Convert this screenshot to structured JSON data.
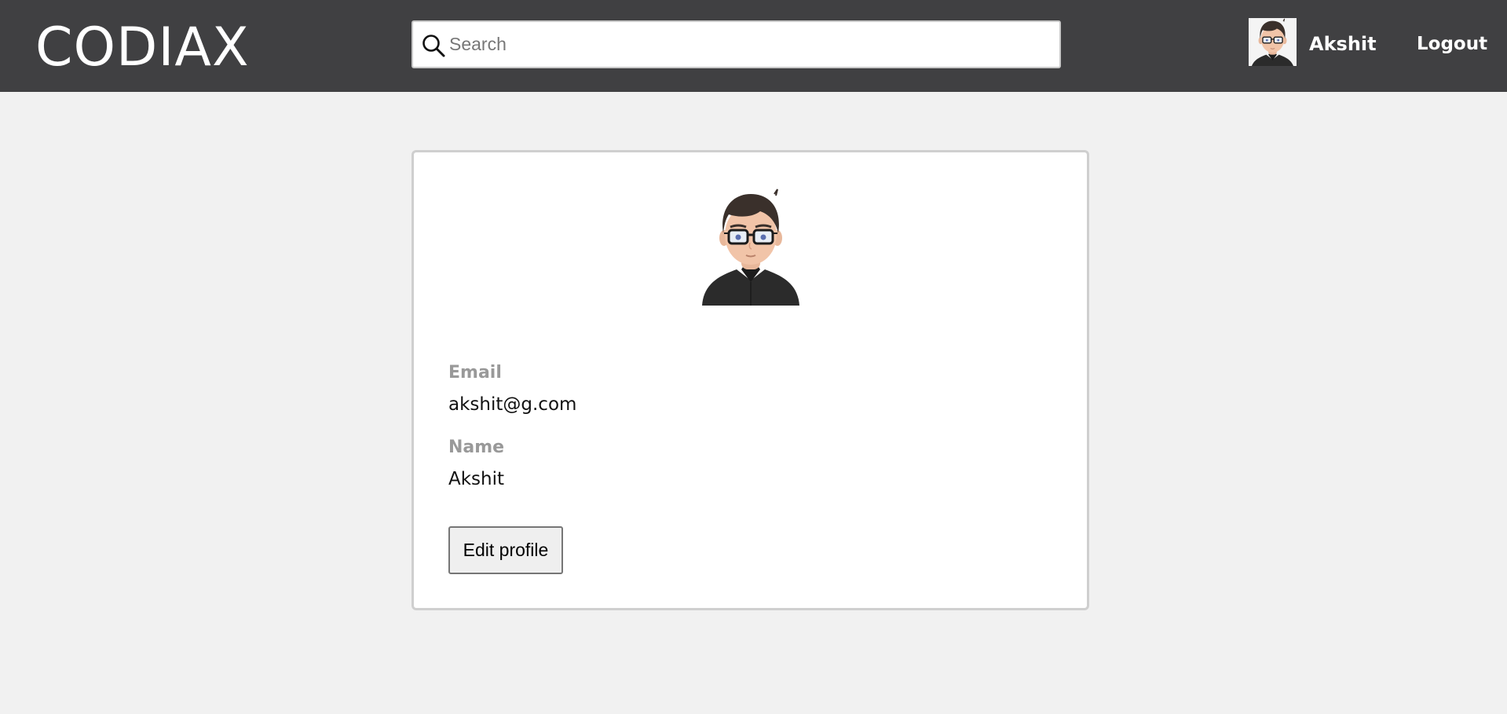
{
  "app": {
    "logo_text": "CODIAX"
  },
  "search": {
    "placeholder": "Search",
    "value": "",
    "icon": "search-icon"
  },
  "user_menu": {
    "avatar_icon": "user-avatar",
    "username": "Akshit",
    "logout_label": "Logout"
  },
  "profile": {
    "avatar_icon": "user-avatar",
    "fields": [
      {
        "label": "Email",
        "value": "akshit@g.com"
      },
      {
        "label": "Name",
        "value": "Akshit"
      }
    ],
    "edit_button_label": "Edit profile"
  },
  "colors": {
    "navbar_bg": "#404042",
    "page_bg": "#f1f1f1",
    "card_bg": "#ffffff",
    "label_gray": "#999999"
  }
}
